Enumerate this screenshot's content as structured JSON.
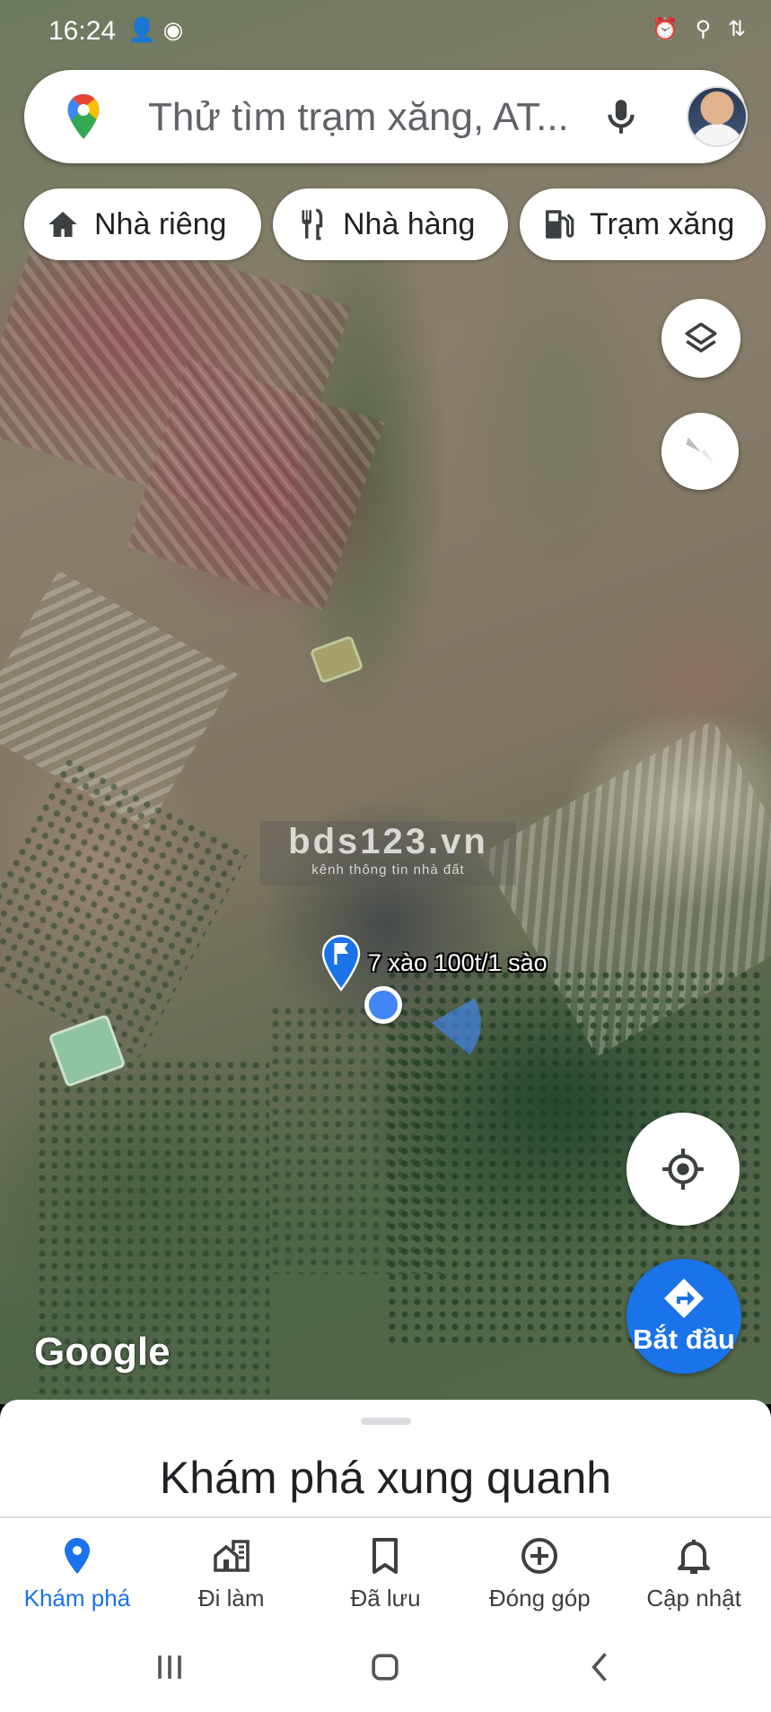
{
  "status_bar": {
    "time": "16:24",
    "left_icons": [
      "person-icon",
      "sync-icon"
    ],
    "right_icons": [
      "alarm-icon",
      "location-icon",
      "4g-icon"
    ]
  },
  "search": {
    "placeholder": "Thử tìm trạm xăng, AT...",
    "icons": [
      "maps-pin-icon",
      "mic-icon",
      "avatar"
    ]
  },
  "chips": [
    {
      "label": "Nhà riêng",
      "icon": "home-icon"
    },
    {
      "label": "Nhà hàng",
      "icon": "restaurant-icon"
    },
    {
      "label": "Trạm xăng",
      "icon": "gas-station-icon"
    }
  ],
  "map": {
    "watermark_title": "bds123.vn",
    "watermark_subtitle": "kênh thông tin nhà đất",
    "marker_label": "7 xào 100t/1 sào",
    "logo": "Google"
  },
  "start_button": {
    "label": "Bắt đầu"
  },
  "sheet": {
    "title": "Khám phá xung quanh"
  },
  "bottom_nav": [
    {
      "label": "Khám phá",
      "icon": "explore-pin-icon",
      "active": true
    },
    {
      "label": "Đi làm",
      "icon": "commute-icon",
      "active": false
    },
    {
      "label": "Đã lưu",
      "icon": "bookmark-icon",
      "active": false
    },
    {
      "label": "Đóng góp",
      "icon": "add-circle-icon",
      "active": false
    },
    {
      "label": "Cập nhật",
      "icon": "bell-icon",
      "active": false
    }
  ],
  "colors": {
    "accent": "#1a73e8",
    "location": "#4285f4"
  }
}
